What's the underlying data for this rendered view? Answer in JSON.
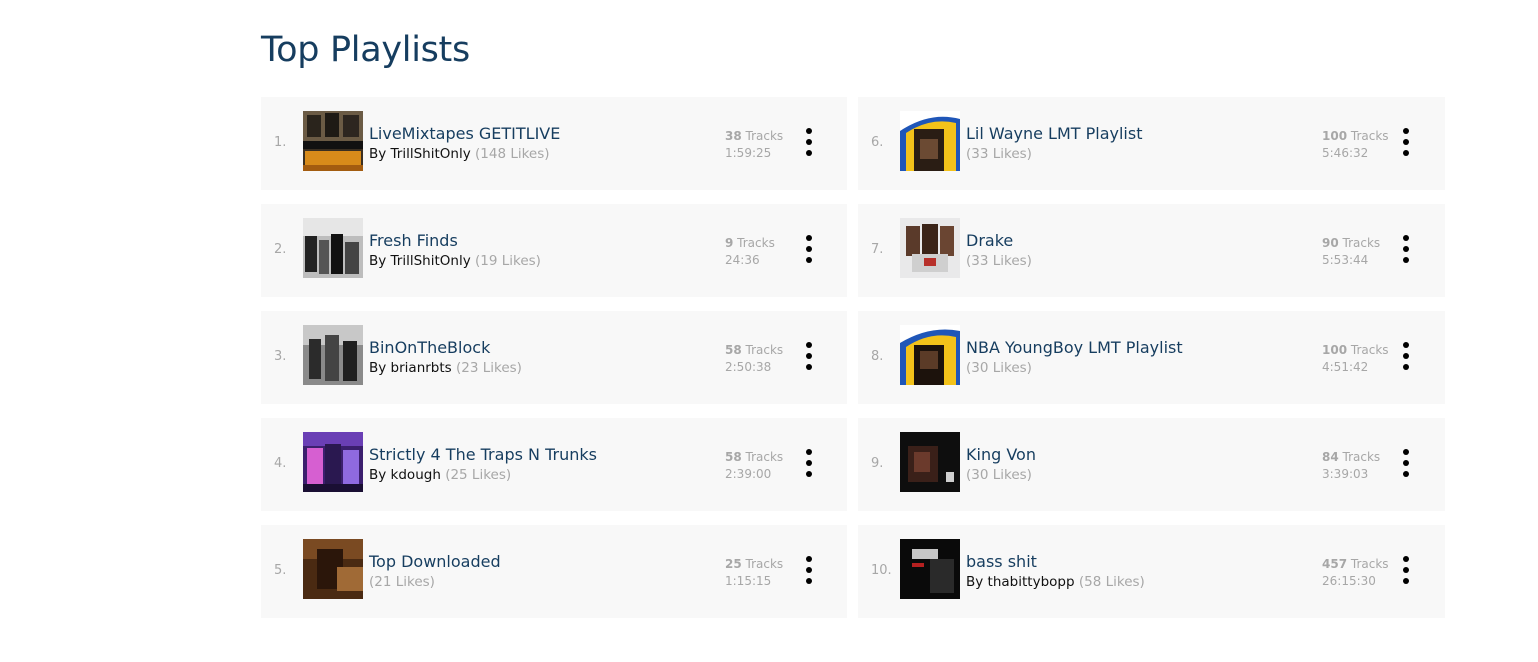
{
  "page": {
    "title": "Top Playlists"
  },
  "playlists": [
    {
      "rank": "1.",
      "name": "LiveMixtapes GETITLIVE",
      "by_prefix": "By ",
      "author": "TrillShitOnly",
      "likes": "(148 Likes)",
      "track_count": "38",
      "tracks_label": " Tracks",
      "duration": "1:59:25",
      "art_icon": "playlist-cover-art"
    },
    {
      "rank": "2.",
      "name": "Fresh Finds",
      "by_prefix": "By ",
      "author": "TrillShitOnly",
      "likes": "(19 Likes)",
      "track_count": "9",
      "tracks_label": " Tracks",
      "duration": "24:36",
      "art_icon": "playlist-cover-art"
    },
    {
      "rank": "3.",
      "name": "BinOnTheBlock",
      "by_prefix": "By ",
      "author": "brianrbts",
      "likes": "(23 Likes)",
      "track_count": "58",
      "tracks_label": " Tracks",
      "duration": "2:50:38",
      "art_icon": "playlist-cover-art"
    },
    {
      "rank": "4.",
      "name": "Strictly 4 The Traps N Trunks",
      "by_prefix": "By ",
      "author": "kdough",
      "likes": "(25 Likes)",
      "track_count": "58",
      "tracks_label": " Tracks",
      "duration": "2:39:00",
      "art_icon": "playlist-cover-art"
    },
    {
      "rank": "5.",
      "name": "Top Downloaded",
      "by_prefix": "",
      "author": "",
      "likes": "(21 Likes)",
      "track_count": "25",
      "tracks_label": " Tracks",
      "duration": "1:15:15",
      "art_icon": "playlist-cover-art"
    },
    {
      "rank": "6.",
      "name": "Lil Wayne LMT Playlist",
      "by_prefix": "",
      "author": "",
      "likes": "(33 Likes)",
      "track_count": "100",
      "tracks_label": " Tracks",
      "duration": "5:46:32",
      "art_icon": "playlist-cover-art"
    },
    {
      "rank": "7.",
      "name": "Drake",
      "by_prefix": "",
      "author": "",
      "likes": "(33 Likes)",
      "track_count": "90",
      "tracks_label": " Tracks",
      "duration": "5:53:44",
      "art_icon": "playlist-cover-art"
    },
    {
      "rank": "8.",
      "name": "NBA YoungBoy LMT Playlist",
      "by_prefix": "",
      "author": "",
      "likes": "(30 Likes)",
      "track_count": "100",
      "tracks_label": " Tracks",
      "duration": "4:51:42",
      "art_icon": "playlist-cover-art"
    },
    {
      "rank": "9.",
      "name": "King Von",
      "by_prefix": "",
      "author": "",
      "likes": "(30 Likes)",
      "track_count": "84",
      "tracks_label": " Tracks",
      "duration": "3:39:03",
      "art_icon": "playlist-cover-art"
    },
    {
      "rank": "10.",
      "name": "bass shit",
      "by_prefix": "By ",
      "author": "thabittybopp",
      "likes": "(58 Likes)",
      "track_count": "457",
      "tracks_label": " Tracks",
      "duration": "26:15:30",
      "art_icon": "playlist-cover-art"
    }
  ],
  "colors": {
    "title": "#163d5f",
    "card_bg": "#f8f8f8",
    "muted": "#a7a7a7",
    "menu_dot": "#000000"
  }
}
